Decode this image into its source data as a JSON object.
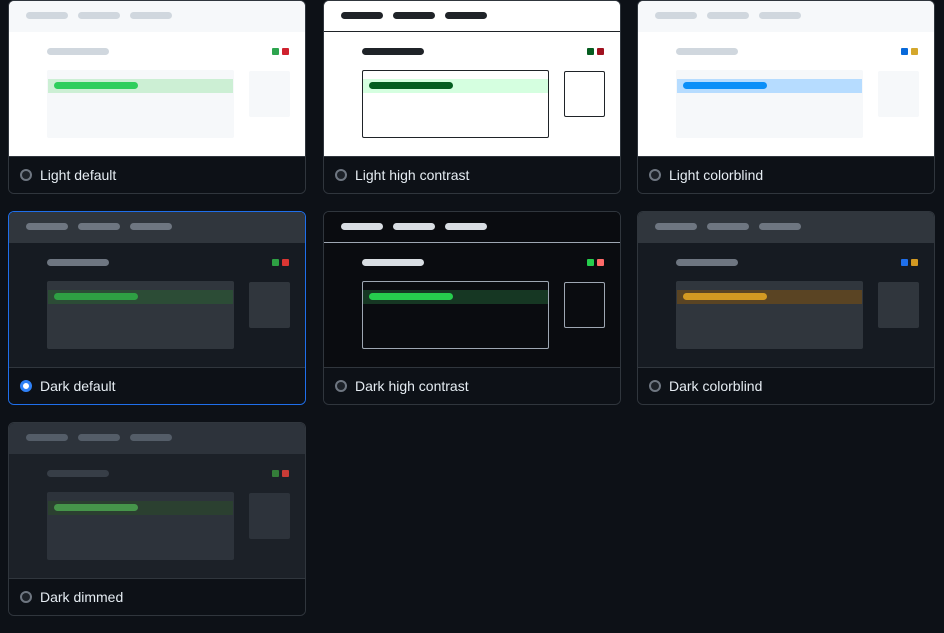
{
  "themes": [
    {
      "label": "Light default",
      "selected": false,
      "colors": {
        "bg": "#ffffff",
        "topbar": "#f6f8fa",
        "topbar_pill": "#d0d7de",
        "heading": "#d0d7de",
        "panel": "#f6f8fa",
        "panel_border": "transparent",
        "hl": "#ccefd4",
        "hl_pill": "#2fce5c",
        "side": "#f6f8fa",
        "side_border": "transparent",
        "dot1": "#2da44e",
        "dot2": "#cf222e",
        "topbar_border": "transparent"
      }
    },
    {
      "label": "Light high contrast",
      "selected": false,
      "colors": {
        "bg": "#ffffff",
        "topbar": "#ffffff",
        "topbar_pill": "#1f2328",
        "heading": "#1f2328",
        "panel": "#ffffff",
        "panel_border": "#1f2328",
        "hl": "#d5ffe0",
        "hl_pill": "#055d20",
        "side": "#ffffff",
        "side_border": "#1f2328",
        "dot1": "#055d20",
        "dot2": "#a0111f",
        "topbar_border": "#1f2328"
      }
    },
    {
      "label": "Light colorblind",
      "selected": false,
      "colors": {
        "bg": "#ffffff",
        "topbar": "#f6f8fa",
        "topbar_pill": "#d0d7de",
        "heading": "#d0d7de",
        "panel": "#f6f8fa",
        "panel_border": "transparent",
        "hl": "#b6dcff",
        "hl_pill": "#0b8ff8",
        "side": "#f6f8fa",
        "side_border": "transparent",
        "dot1": "#0969da",
        "dot2": "#d4a72c",
        "topbar_border": "transparent"
      }
    },
    {
      "label": "Dark default",
      "selected": true,
      "colors": {
        "bg": "#161b22",
        "topbar": "#30363d",
        "topbar_pill": "#6e7681",
        "heading": "#6e7681",
        "panel": "#30363d",
        "panel_border": "transparent",
        "hl": "#2c4c36",
        "hl_pill": "#2ea043",
        "side": "#30363d",
        "side_border": "transparent",
        "dot1": "#2ea043",
        "dot2": "#da3633",
        "topbar_border": "transparent"
      }
    },
    {
      "label": "Dark high contrast",
      "selected": false,
      "colors": {
        "bg": "#0a0c10",
        "topbar": "#0a0c10",
        "topbar_pill": "#d9dee3",
        "heading": "#d9dee3",
        "panel": "#0a0c10",
        "panel_border": "#9ea7b3",
        "hl": "#163723",
        "hl_pill": "#26cd4d",
        "side": "#0a0c10",
        "side_border": "#9ea7b3",
        "dot1": "#26cd4d",
        "dot2": "#ff6a69",
        "topbar_border": "#9ea7b3"
      }
    },
    {
      "label": "Dark colorblind",
      "selected": false,
      "colors": {
        "bg": "#161b22",
        "topbar": "#30363d",
        "topbar_pill": "#6e7681",
        "heading": "#6e7681",
        "panel": "#30363d",
        "panel_border": "transparent",
        "hl": "#5a4423",
        "hl_pill": "#d29922",
        "side": "#30363d",
        "side_border": "transparent",
        "dot1": "#1f6feb",
        "dot2": "#d29922",
        "topbar_border": "transparent"
      }
    },
    {
      "label": "Dark dimmed",
      "selected": false,
      "colors": {
        "bg": "#1c2128",
        "topbar": "#2d333b",
        "topbar_pill": "#545d68",
        "heading": "#373e47",
        "panel": "#2d333b",
        "panel_border": "transparent",
        "hl": "#2b4030",
        "hl_pill": "#46954a",
        "side": "#2d333b",
        "side_border": "transparent",
        "dot1": "#347d39",
        "dot2": "#c93c37",
        "topbar_border": "transparent"
      }
    }
  ]
}
